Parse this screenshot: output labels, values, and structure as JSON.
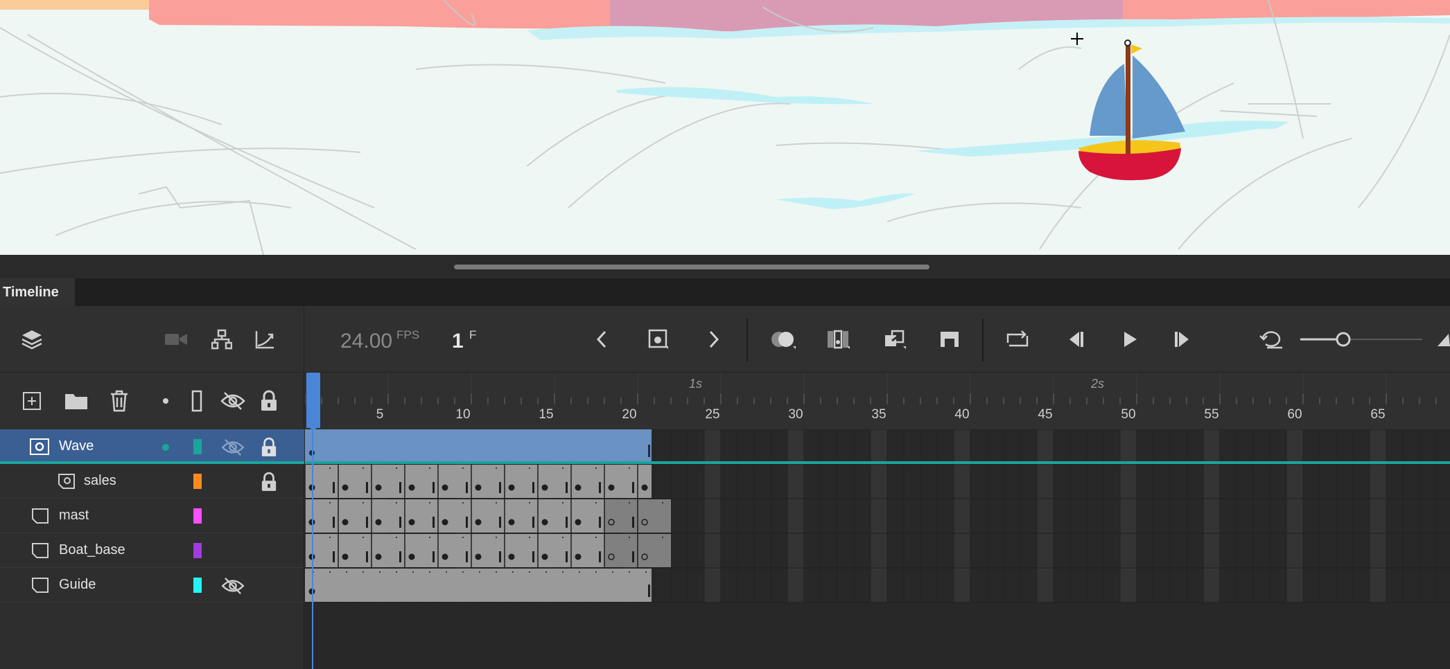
{
  "panel": {
    "tab_label": "Timeline"
  },
  "toolbar": {
    "fps_value": "24.00",
    "fps_unit": "FPS",
    "current_frame": "1",
    "frame_unit": "F"
  },
  "ruler": {
    "seconds_labels": [
      "1s",
      "2s"
    ],
    "frame_labels": [
      "5",
      "10",
      "15",
      "20",
      "25",
      "30",
      "35",
      "40",
      "45",
      "50",
      "55",
      "60",
      "65"
    ]
  },
  "layers": [
    {
      "name": "Wave",
      "type": "mask",
      "color": "#1aa59b",
      "selected": true,
      "hidden": true,
      "locked": true
    },
    {
      "name": "sales",
      "type": "masked",
      "color": "#ff8a1f",
      "selected": false,
      "hidden": false,
      "locked": true
    },
    {
      "name": "mast",
      "type": "normal",
      "color": "#ff4dff",
      "selected": false,
      "hidden": false,
      "locked": false
    },
    {
      "name": "Boat_base",
      "type": "normal",
      "color": "#a23ce0",
      "selected": false,
      "hidden": false,
      "locked": false
    },
    {
      "name": "Guide",
      "type": "normal",
      "color": "#22f4f4",
      "selected": false,
      "hidden": true,
      "locked": false
    }
  ],
  "colors": {
    "accent": "#4a86d8",
    "selection": "#3a5f93"
  },
  "icons": {
    "layers": "layers-icon",
    "camera": "camera-icon",
    "hierarchy": "hierarchy-icon",
    "ease": "ease-graph-icon"
  }
}
